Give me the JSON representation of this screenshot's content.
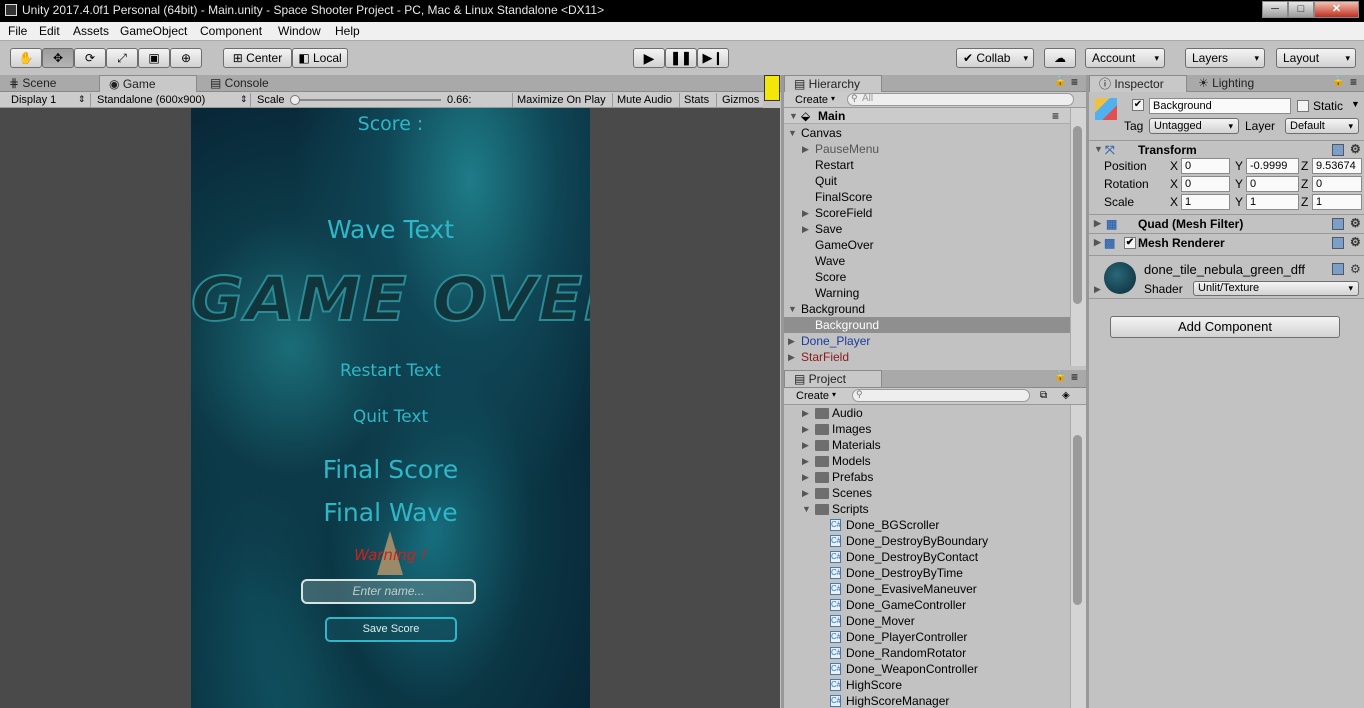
{
  "window": {
    "title": "Unity 2017.4.0f1 Personal (64bit) - Main.unity - Space Shooter Project - PC, Mac & Linux Standalone <DX11>",
    "min": "─",
    "max": "□",
    "close": "✕"
  },
  "menu": [
    "File",
    "Edit",
    "Assets",
    "GameObject",
    "Component",
    "Window",
    "Help"
  ],
  "toolbar": {
    "pivot": "Center",
    "space": "Local",
    "collab": "Collab",
    "account": "Account",
    "layers": "Layers",
    "layout": "Layout"
  },
  "tabs": {
    "scene": "Scene",
    "game": "Game",
    "console": "Console",
    "hierarchy": "Hierarchy",
    "project": "Project",
    "inspector": "Inspector",
    "lighting": "Lighting"
  },
  "game_bar": {
    "display": "Display 1",
    "resolution": "Standalone (600x900)",
    "scale_label": "Scale",
    "scale_value": "0.66:",
    "maximize": "Maximize On Play",
    "mute": "Mute Audio",
    "stats": "Stats",
    "gizmos": "Gizmos"
  },
  "game": {
    "score": "Score :",
    "wave_text": "Wave Text",
    "game_over": "GAME OVER",
    "restart": "Restart Text",
    "quit": "Quit Text",
    "final_score": "Final Score",
    "final_wave": "Final Wave",
    "warning": "Warning !",
    "name_placeholder": "Enter name...",
    "save_button": "Save Score"
  },
  "hierarchy": {
    "create": "Create",
    "search_placeholder": "All",
    "scene": "Main",
    "items": [
      {
        "label": "Canvas",
        "indent": 1,
        "arrow": "open"
      },
      {
        "label": "PauseMenu",
        "indent": 2,
        "arrow": "closed",
        "state": "inactive"
      },
      {
        "label": "Restart",
        "indent": 2
      },
      {
        "label": "Quit",
        "indent": 2
      },
      {
        "label": "FinalScore",
        "indent": 2
      },
      {
        "label": "ScoreField",
        "indent": 2,
        "arrow": "closed"
      },
      {
        "label": "Save",
        "indent": 2,
        "arrow": "closed"
      },
      {
        "label": "GameOver",
        "indent": 2
      },
      {
        "label": "Wave",
        "indent": 2
      },
      {
        "label": "Score",
        "indent": 2
      },
      {
        "label": "Warning",
        "indent": 2
      },
      {
        "label": "Background",
        "indent": 1,
        "arrow": "open"
      },
      {
        "label": "Background",
        "indent": 2,
        "selected": true
      },
      {
        "label": "Done_Player",
        "indent": 1,
        "arrow": "closed",
        "state": "prefab"
      },
      {
        "label": "StarField",
        "indent": 1,
        "arrow": "closed",
        "state": "broken-prefab"
      }
    ]
  },
  "project": {
    "create": "Create",
    "folders": [
      {
        "label": "Audio",
        "arrow": "closed"
      },
      {
        "label": "Images",
        "arrow": "closed"
      },
      {
        "label": "Materials",
        "arrow": "closed"
      },
      {
        "label": "Models",
        "arrow": "closed"
      },
      {
        "label": "Prefabs",
        "arrow": "closed"
      },
      {
        "label": "Scenes",
        "arrow": "closed"
      },
      {
        "label": "Scripts",
        "arrow": "open"
      }
    ],
    "scripts": [
      "Done_BGScroller",
      "Done_DestroyByBoundary",
      "Done_DestroyByContact",
      "Done_DestroyByTime",
      "Done_EvasiveManeuver",
      "Done_GameController",
      "Done_Mover",
      "Done_PlayerController",
      "Done_RandomRotator",
      "Done_WeaponController",
      "HighScore",
      "HighScoreManager"
    ]
  },
  "inspector": {
    "object_name": "Background",
    "static_label": "Static",
    "tag_label": "Tag",
    "tag_value": "Untagged",
    "layer_label": "Layer",
    "layer_value": "Default",
    "transform": {
      "title": "Transform",
      "position": {
        "label": "Position",
        "x": "0",
        "y": "-0.9999",
        "z": "9.53674"
      },
      "rotation": {
        "label": "Rotation",
        "x": "0",
        "y": "0",
        "z": "0"
      },
      "scale": {
        "label": "Scale",
        "x": "1",
        "y": "1",
        "z": "1"
      }
    },
    "mesh_filter": "Quad (Mesh Filter)",
    "mesh_renderer": "Mesh Renderer",
    "material": {
      "name": "done_tile_nebula_green_dff",
      "shader_label": "Shader",
      "shader_value": "Unlit/Texture"
    },
    "add_component": "Add Component"
  },
  "axis": {
    "x": "X",
    "y": "Y",
    "z": "Z"
  }
}
